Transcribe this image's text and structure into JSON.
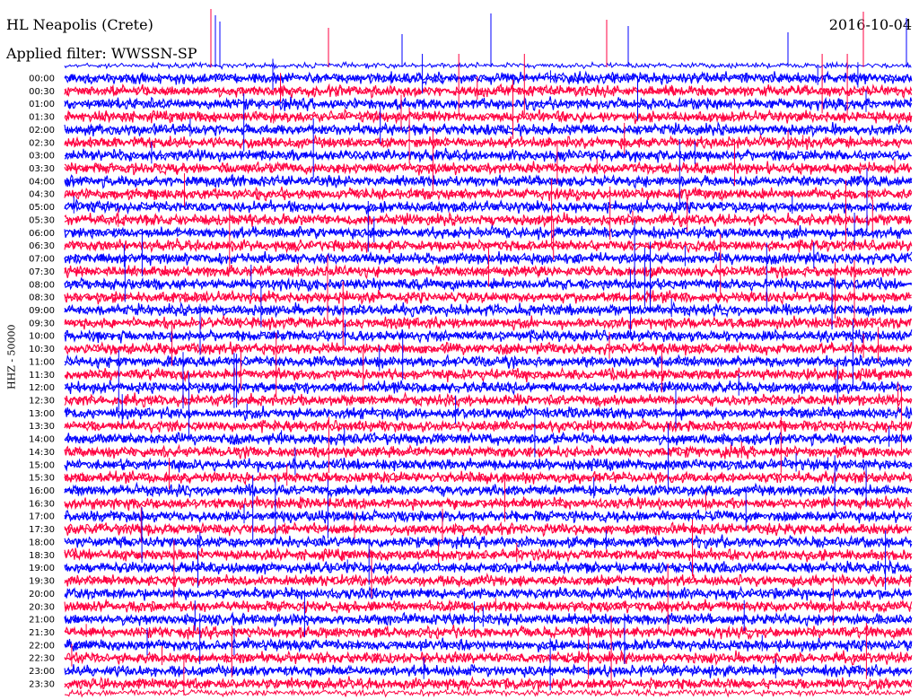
{
  "header": {
    "station": "HL Neapolis (Crete)",
    "filter": "Applied filter: WWSSN-SP",
    "date": "2016-10-04"
  },
  "channel_label": "HHZ - 50000",
  "chart_data": {
    "type": "line",
    "title": "HL Neapolis (Crete)",
    "subtitle": "Applied filter: WWSSN-SP",
    "date": "2016-10-04",
    "ylabel": "HHZ - 50000",
    "xlabel": "",
    "grid": false,
    "legend": "none",
    "colors": [
      "#0000ff",
      "#ff0040"
    ],
    "rows": [
      "00:00",
      "00:30",
      "01:00",
      "01:30",
      "02:00",
      "02:30",
      "03:00",
      "03:30",
      "04:00",
      "04:30",
      "05:00",
      "05:30",
      "06:00",
      "06:30",
      "07:00",
      "07:30",
      "08:00",
      "08:30",
      "09:00",
      "09:30",
      "10:00",
      "10:30",
      "11:00",
      "11:30",
      "12:00",
      "12:30",
      "13:00",
      "13:30",
      "14:00",
      "14:30",
      "15:00",
      "15:30",
      "16:00",
      "16:30",
      "17:00",
      "17:30",
      "18:00",
      "18:30",
      "19:00",
      "19:30",
      "20:00",
      "20:30",
      "21:00",
      "21:30",
      "22:00",
      "22:30",
      "23:00",
      "23:30"
    ],
    "row_interval_minutes": 30
  }
}
